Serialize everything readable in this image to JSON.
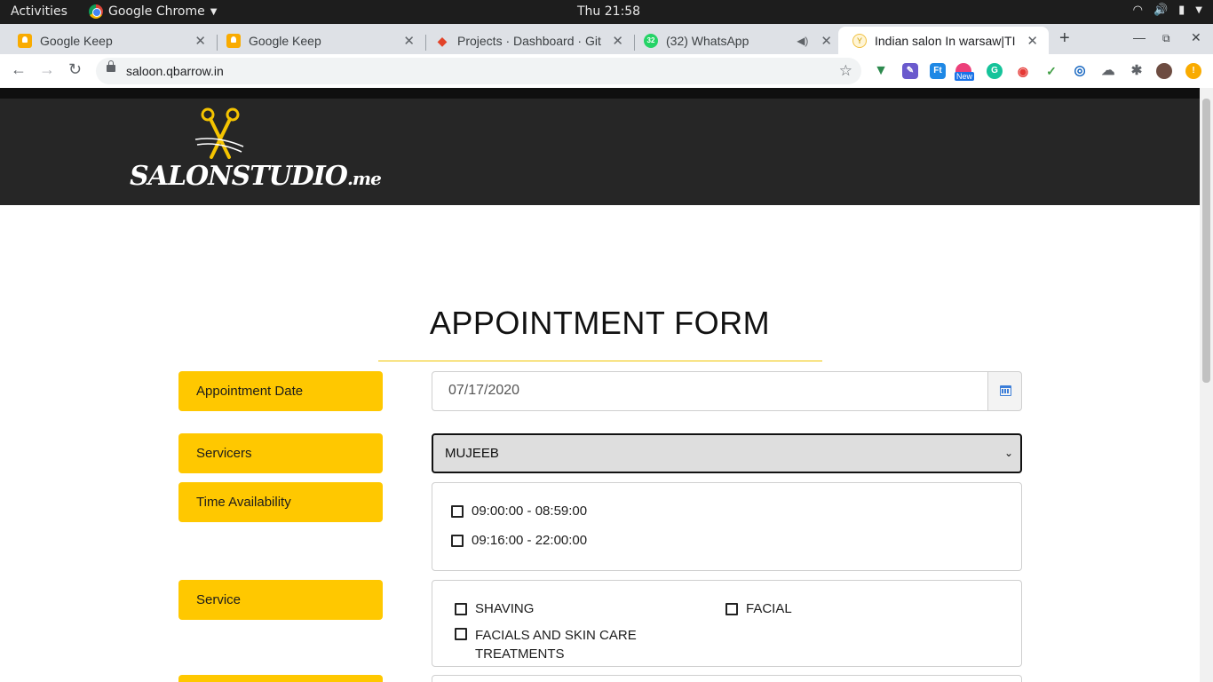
{
  "desktop": {
    "activities": "Activities",
    "app_name": "Google Chrome",
    "clock": "Thu 21:58"
  },
  "tabs": [
    {
      "title": "Google Keep",
      "icon": "google-keep-icon"
    },
    {
      "title": "Google Keep",
      "icon": "google-keep-icon"
    },
    {
      "title": "Projects · Dashboard · Git",
      "icon": "gitlab-icon"
    },
    {
      "title": "(32) WhatsApp",
      "icon": "whatsapp-icon",
      "badge": "32"
    },
    {
      "title": "Indian salon In warsaw|TI",
      "icon": "salon-icon",
      "active": true
    }
  ],
  "browser": {
    "url": "saloon.qbarrow.in",
    "extension_new_badge": "New"
  },
  "site": {
    "logo_text": "SALONSTUDIO",
    "logo_suffix": ".me"
  },
  "form": {
    "title": "APPOINTMENT FORM",
    "date_label": "Appointment Date",
    "date_value": "07/17/2020",
    "servicers_label": "Servicers",
    "servicer_selected": "MUJEEB",
    "time_label": "Time Availability",
    "time_slots": [
      "09:00:00 - 08:59:00",
      "09:16:00 - 22:00:00"
    ],
    "service_label": "Service",
    "services": [
      "SHAVING",
      "FACIAL",
      "FACIALS AND SKIN CARE TREATMENTS"
    ]
  },
  "colors": {
    "accent_yellow": "#ffc800",
    "header_dark": "#262626"
  }
}
